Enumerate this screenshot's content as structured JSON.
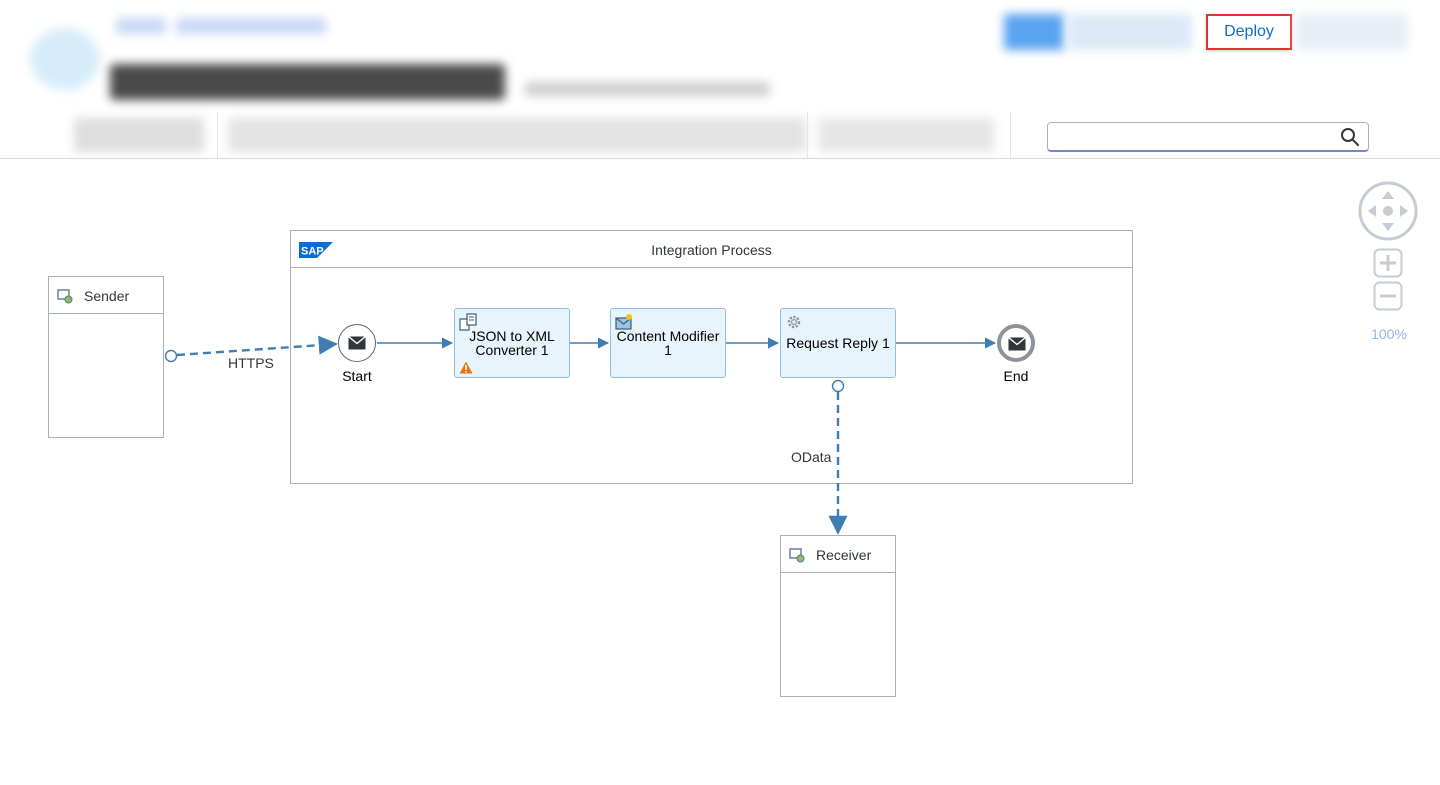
{
  "toolbar": {
    "deploy_label": "Deploy",
    "search_placeholder": ""
  },
  "zoom": {
    "level": "100%"
  },
  "diagram": {
    "pool_title": "Integration Process",
    "sender_label": "Sender",
    "receiver_label": "Receiver",
    "start_label": "Start",
    "end_label": "End",
    "steps": [
      {
        "line1": "JSON to XML",
        "line2": "Converter 1",
        "has_warning": true
      },
      {
        "line1": "Content Modifier",
        "line2": "1"
      },
      {
        "line1": "Request Reply 1",
        "line2": ""
      }
    ],
    "sender_channel": "HTTPS",
    "receiver_channel": "OData"
  },
  "colors": {
    "accent": "#0a6ed1",
    "highlight_border": "#e03131",
    "task_fill": "#e8f4fc",
    "task_border": "#8dc0e8",
    "flow_line": "#3f7eb3",
    "warning": "#e9730c"
  }
}
